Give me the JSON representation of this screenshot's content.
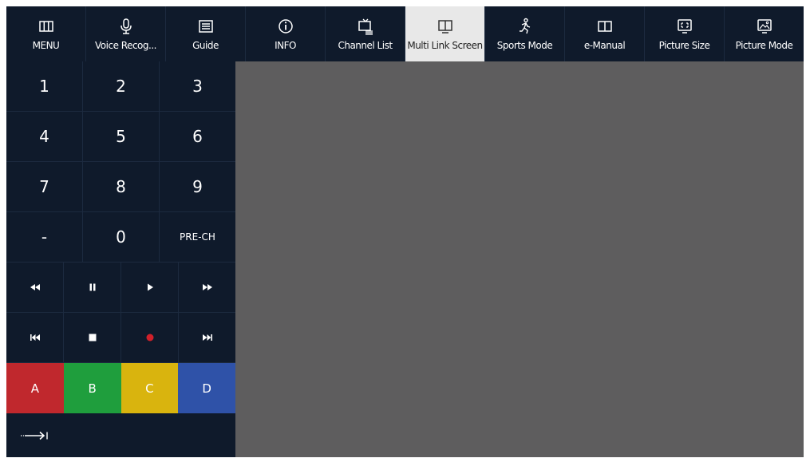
{
  "topbar": {
    "items": [
      {
        "label": "MENU",
        "icon": "menu-icon"
      },
      {
        "label": "Voice Recog...",
        "icon": "microphone-icon"
      },
      {
        "label": "Guide",
        "icon": "guide-icon"
      },
      {
        "label": "INFO",
        "icon": "info-icon"
      },
      {
        "label": "Channel List",
        "icon": "channel-list-icon"
      },
      {
        "label": "Multi Link Screen",
        "icon": "multi-link-screen-icon",
        "active": true
      },
      {
        "label": "Sports Mode",
        "icon": "sports-mode-icon"
      },
      {
        "label": "e-Manual",
        "icon": "e-manual-icon"
      },
      {
        "label": "Picture Size",
        "icon": "picture-size-icon"
      },
      {
        "label": "Picture Mode",
        "icon": "picture-mode-icon"
      }
    ]
  },
  "keypad": {
    "numbers": [
      "1",
      "2",
      "3",
      "4",
      "5",
      "6",
      "7",
      "8",
      "9"
    ],
    "dash": "-",
    "zero": "0",
    "prech": "PRE-CH",
    "media_row1": [
      "rewind-icon",
      "pause-icon",
      "play-icon",
      "fast-forward-icon"
    ],
    "media_row2": [
      "skip-back-icon",
      "stop-icon",
      "record-icon",
      "skip-forward-icon"
    ],
    "color_keys": [
      {
        "label": "A",
        "color": "#c0282d"
      },
      {
        "label": "B",
        "color": "#1f9e3d"
      },
      {
        "label": "C",
        "color": "#d9b40e"
      },
      {
        "label": "D",
        "color": "#2f52a8"
      }
    ],
    "arrow_icon": "arrow-to-bar-icon"
  },
  "colors": {
    "background": "#0f1a2b",
    "active_tab": "#e8e8e8",
    "main_area": "#5e5d5e",
    "record": "#d0202a"
  }
}
